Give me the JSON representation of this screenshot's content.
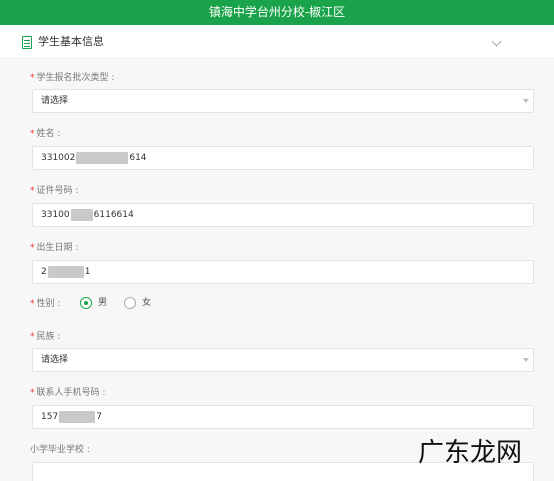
{
  "header": {
    "title": "镇海中学台州分校-椒江区"
  },
  "section": {
    "title": "学生基本信息"
  },
  "form": {
    "batch_type": {
      "label": "学生报名批次类型 :",
      "value": "请选择"
    },
    "name": {
      "label": "姓名 :",
      "value_start": "331002",
      "value_end": "614"
    },
    "id_number": {
      "label": "证件号码 :",
      "value_start": "33100",
      "value_end": "6116614"
    },
    "birth_date": {
      "label": "出生日期 :",
      "value_start": "2",
      "value_end": "1"
    },
    "gender": {
      "label": "性别 :",
      "option_male": "男",
      "option_female": "女",
      "selected": "男"
    },
    "ethnicity": {
      "label": "民族 :",
      "value": "请选择"
    },
    "phone": {
      "label": "联系人手机号码 :",
      "value_start": "157",
      "value_end": "7"
    },
    "primary_school": {
      "label": "小学毕业学校 :",
      "value": ""
    }
  },
  "watermark": {
    "text": "广东龙网"
  },
  "colors": {
    "accent": "#1aa34a",
    "required": "#e33333"
  }
}
